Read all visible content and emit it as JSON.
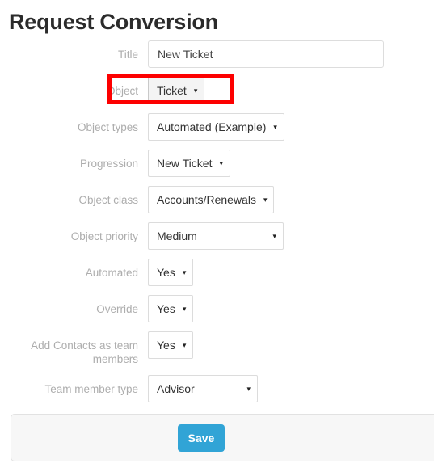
{
  "page_title": "Request Conversion",
  "form": {
    "rows": [
      {
        "label": "Title",
        "type": "text",
        "value": "New Ticket",
        "name": "title"
      },
      {
        "label": "Object",
        "type": "select",
        "value": "Ticket",
        "caret": "▾",
        "name": "object",
        "style": "grey",
        "highlighted": true
      },
      {
        "label": "Object types",
        "type": "select",
        "value": "Automated (Example)",
        "caret": "▾",
        "name": "object-types"
      },
      {
        "label": "Progression",
        "type": "select",
        "value": "New Ticket",
        "caret": "▾",
        "name": "progression"
      },
      {
        "label": "Object class",
        "type": "select",
        "value": "Accounts/Renewals",
        "caret": "▾",
        "name": "object-class"
      },
      {
        "label": "Object priority",
        "type": "select",
        "value": "Medium",
        "caret": "▾",
        "name": "object-priority",
        "style": "wide"
      },
      {
        "label": "Automated",
        "type": "select",
        "value": "Yes",
        "caret": "▾",
        "name": "automated"
      },
      {
        "label": "Override",
        "type": "select",
        "value": "Yes",
        "caret": "▾",
        "name": "override"
      },
      {
        "label": "Add Contacts as team members",
        "type": "select",
        "value": "Yes",
        "caret": "▾",
        "name": "add-contacts-as-team-members"
      },
      {
        "label": "Team member type",
        "type": "select",
        "value": "Advisor",
        "caret": "▾",
        "name": "team-member-type",
        "style": "medwide"
      }
    ]
  },
  "footer": {
    "save_label": "Save"
  },
  "colors": {
    "accent_blue": "#31a4d6",
    "highlight_red": "#fd0000",
    "label_grey": "#adadad",
    "panel_grey": "#f7f7f7"
  }
}
